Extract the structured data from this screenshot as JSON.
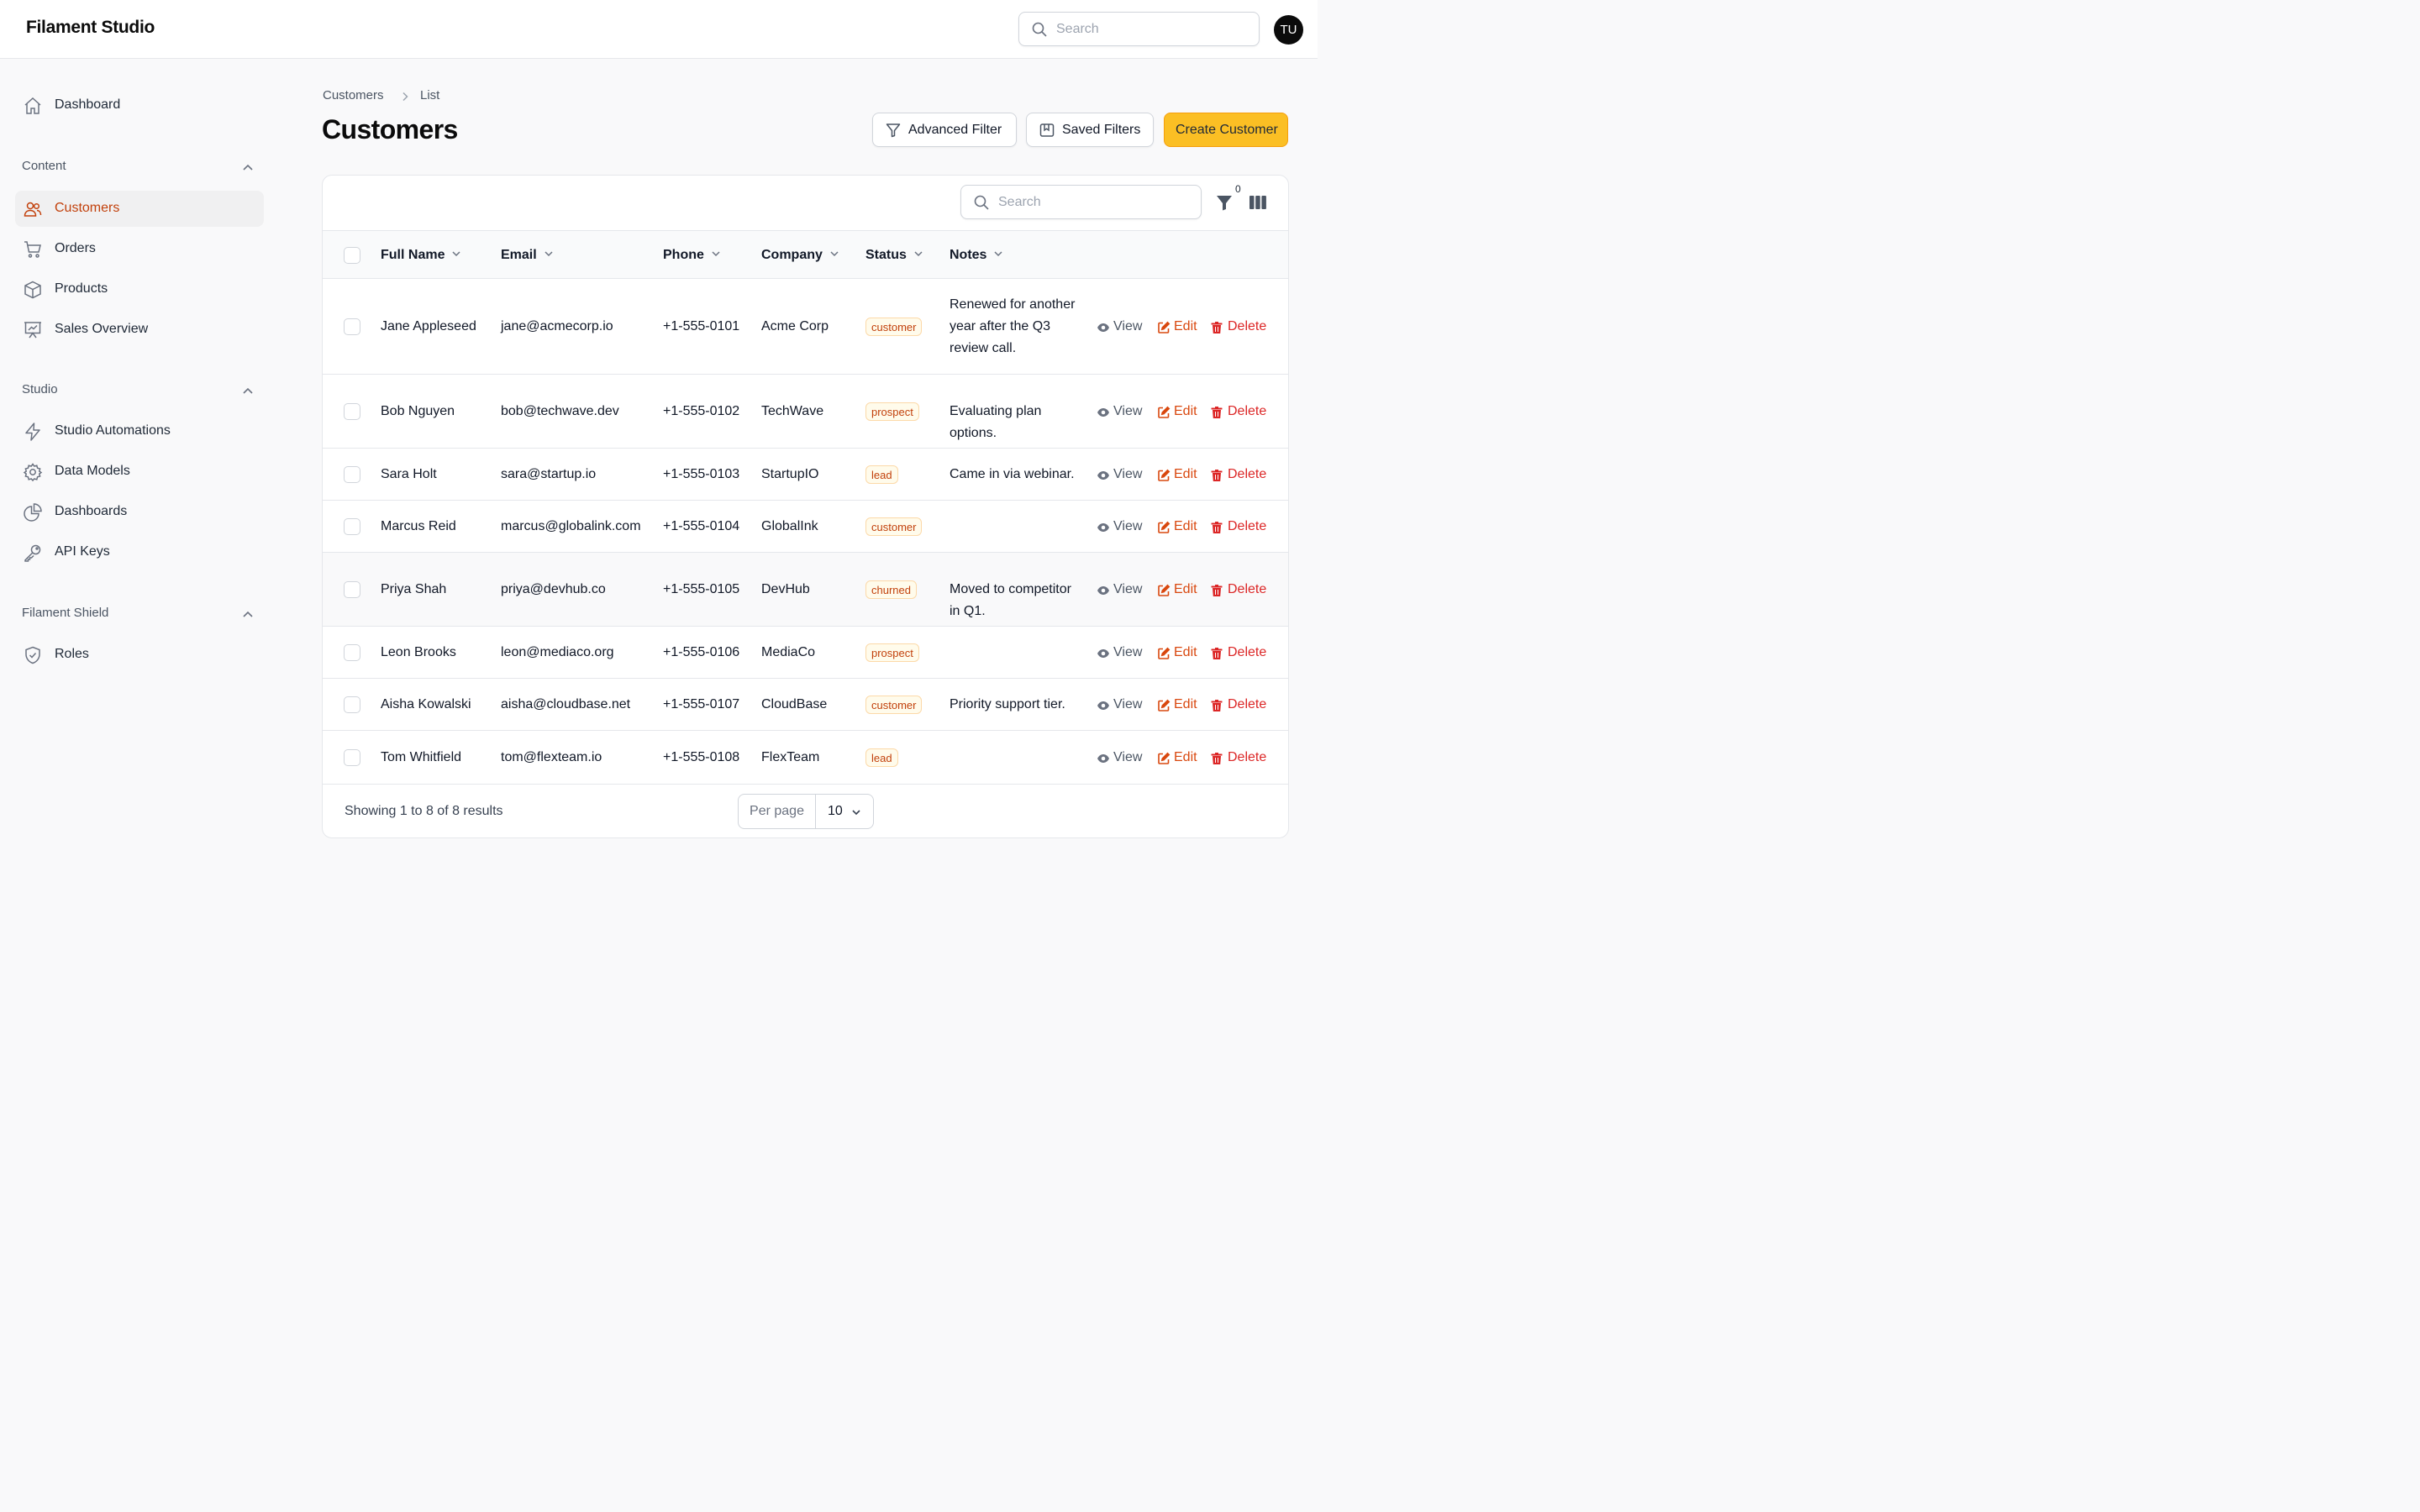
{
  "app": {
    "title": "Filament Studio"
  },
  "topbar": {
    "search_placeholder": "Search",
    "avatar_initials": "TU"
  },
  "sidebar": {
    "dashboard": "Dashboard",
    "groups": [
      {
        "label": "Content",
        "items": [
          "Customers",
          "Orders",
          "Products",
          "Sales Overview"
        ]
      },
      {
        "label": "Studio",
        "items": [
          "Studio Automations",
          "Data Models",
          "Dashboards",
          "API Keys"
        ]
      },
      {
        "label": "Filament Shield",
        "items": [
          "Roles"
        ]
      }
    ],
    "active_item": "Customers"
  },
  "breadcrumb": [
    "Customers",
    "List"
  ],
  "page": {
    "title": "Customers"
  },
  "actions": {
    "advanced_filter": "Advanced Filter",
    "saved_filters": "Saved Filters",
    "create": "Create Customer"
  },
  "table": {
    "search_placeholder": "Search",
    "active_filters_count": "0",
    "columns": [
      "Full Name",
      "Email",
      "Phone",
      "Company",
      "Status",
      "Notes"
    ],
    "row_actions": {
      "view": "View",
      "edit": "Edit",
      "delete": "Delete"
    },
    "rows": [
      {
        "name": "Jane Appleseed",
        "email": "jane@acmecorp.io",
        "phone": "+1-555-0101",
        "company": "Acme Corp",
        "status": "customer",
        "notes": "Renewed for another year after the Q3 review call."
      },
      {
        "name": "Bob Nguyen",
        "email": "bob@techwave.dev",
        "phone": "+1-555-0102",
        "company": "TechWave",
        "status": "prospect",
        "notes": "Evaluating plan options."
      },
      {
        "name": "Sara Holt",
        "email": "sara@startup.io",
        "phone": "+1-555-0103",
        "company": "StartupIO",
        "status": "lead",
        "notes": "Came in via webinar."
      },
      {
        "name": "Marcus Reid",
        "email": "marcus@globalink.com",
        "phone": "+1-555-0104",
        "company": "GlobalInk",
        "status": "customer",
        "notes": ""
      },
      {
        "name": "Priya Shah",
        "email": "priya@devhub.co",
        "phone": "+1-555-0105",
        "company": "DevHub",
        "status": "churned",
        "notes": "Moved to competitor in Q1."
      },
      {
        "name": "Leon Brooks",
        "email": "leon@mediaco.org",
        "phone": "+1-555-0106",
        "company": "MediaCo",
        "status": "prospect",
        "notes": ""
      },
      {
        "name": "Aisha Kowalski",
        "email": "aisha@cloudbase.net",
        "phone": "+1-555-0107",
        "company": "CloudBase",
        "status": "customer",
        "notes": "Priority support tier."
      },
      {
        "name": "Tom Whitfield",
        "email": "tom@flexteam.io",
        "phone": "+1-555-0108",
        "company": "FlexTeam",
        "status": "lead",
        "notes": ""
      }
    ]
  },
  "pagination": {
    "summary": "Showing 1 to 8 of 8 results",
    "per_page_label": "Per page",
    "per_page_value": "10"
  },
  "colors": {
    "accent": "#c2410c",
    "primary_button": "#fbbf24",
    "danger": "#dc2626",
    "edit": "#d9480f"
  }
}
